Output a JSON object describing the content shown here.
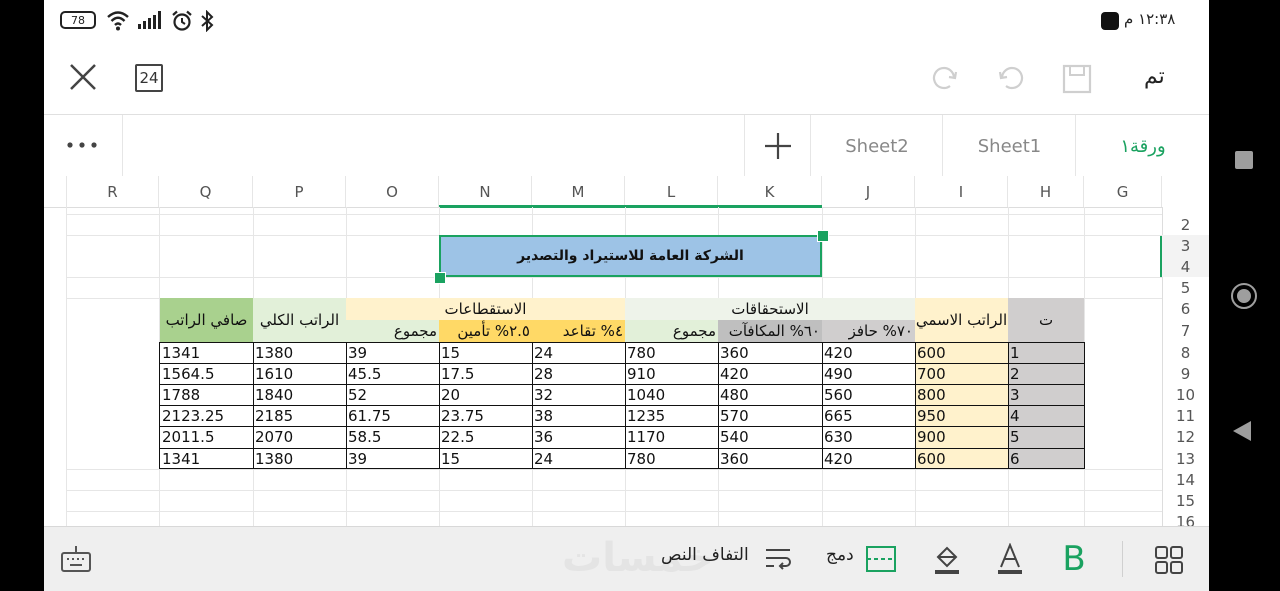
{
  "status": {
    "time": "١٢:٣٨ م",
    "battery": "78"
  },
  "toolbar": {
    "done_label": "تم",
    "page_count": "24"
  },
  "tabs": [
    {
      "label": "ورقة١"
    },
    {
      "label": "Sheet1"
    },
    {
      "label": "Sheet2"
    }
  ],
  "columns": [
    "R",
    "Q",
    "P",
    "O",
    "N",
    "M",
    "L",
    "K",
    "J",
    "I",
    "H",
    "G"
  ],
  "rows": [
    "2",
    "3",
    "4",
    "5",
    "6",
    "7",
    "8",
    "9",
    "10",
    "11",
    "12",
    "13",
    "14",
    "15",
    "16"
  ],
  "sheet": {
    "title": "الشركة العامة للاستيراد والتصدير",
    "headers": {
      "t": "ت",
      "nominal": "الراتب الاسمي",
      "entitlements": "الاستحقاقات",
      "incentive": "٧٠% حافز",
      "bonuses": "٦٠% المكافآت",
      "ent_total": "مجموع",
      "deductions": "الاستقطاعات",
      "retirement": "٤% تقاعد",
      "insurance": "٢.٥% تأمين",
      "ded_total": "مجموع",
      "gross": "الراتب الكلي",
      "net": "صافي الراتب"
    },
    "records": [
      {
        "t": "1",
        "nominal": "600",
        "incentive": "420",
        "bonuses": "360",
        "ent_total": "780",
        "retirement": "24",
        "insurance": "15",
        "ded_total": "39",
        "gross": "1380",
        "net": "1341"
      },
      {
        "t": "2",
        "nominal": "700",
        "incentive": "490",
        "bonuses": "420",
        "ent_total": "910",
        "retirement": "28",
        "insurance": "17.5",
        "ded_total": "45.5",
        "gross": "1610",
        "net": "1564.5"
      },
      {
        "t": "3",
        "nominal": "800",
        "incentive": "560",
        "bonuses": "480",
        "ent_total": "1040",
        "retirement": "32",
        "insurance": "20",
        "ded_total": "52",
        "gross": "1840",
        "net": "1788"
      },
      {
        "t": "4",
        "nominal": "950",
        "incentive": "665",
        "bonuses": "570",
        "ent_total": "1235",
        "retirement": "38",
        "insurance": "23.75",
        "ded_total": "61.75",
        "gross": "2185",
        "net": "2123.25"
      },
      {
        "t": "5",
        "nominal": "900",
        "incentive": "630",
        "bonuses": "540",
        "ent_total": "1170",
        "retirement": "36",
        "insurance": "22.5",
        "ded_total": "58.5",
        "gross": "2070",
        "net": "2011.5"
      },
      {
        "t": "6",
        "nominal": "600",
        "incentive": "420",
        "bonuses": "360",
        "ent_total": "780",
        "retirement": "24",
        "insurance": "15",
        "ded_total": "39",
        "gross": "1380",
        "net": "1341"
      }
    ]
  },
  "bottom": {
    "wrap_label": "التفاف النص",
    "merge_label": "دمج",
    "watermark": "خمسات"
  },
  "colors": {
    "accent": "#1aa260",
    "title_fill": "#9dc3e6",
    "yellow": "#fff2cc",
    "orange": "#ffd966",
    "green": "#c6e0b4",
    "gray": "#d0cece"
  }
}
